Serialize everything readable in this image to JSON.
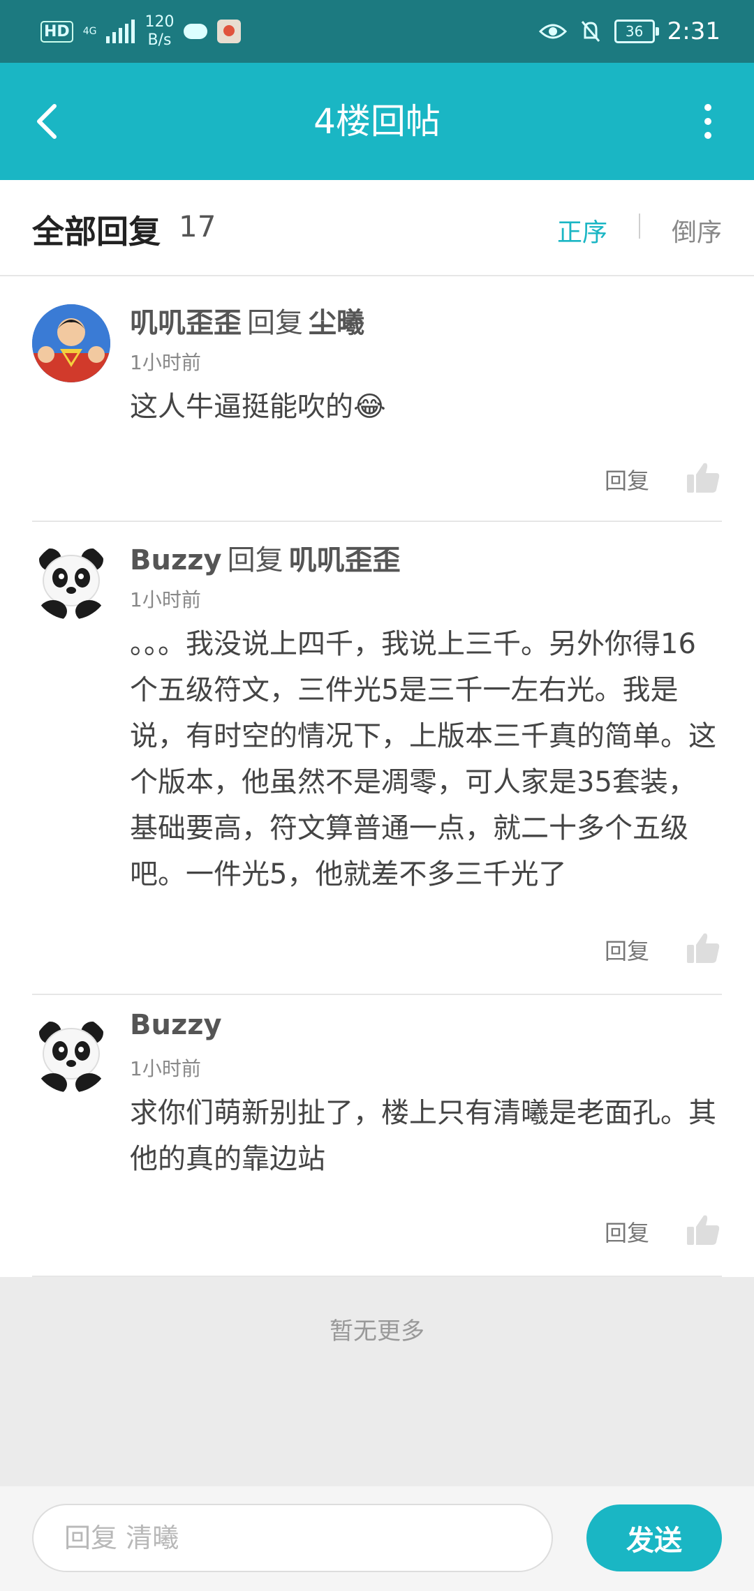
{
  "status_bar": {
    "hd": "HD",
    "network": "4G",
    "speed_value": "120",
    "speed_unit": "B/s",
    "battery": "36",
    "time": "2:31"
  },
  "nav": {
    "title": "4楼回帖",
    "icons": [
      "back-arrow-icon",
      "more-vertical-icon"
    ]
  },
  "replies_header": {
    "title": "全部回复",
    "count": "17",
    "sort_asc": "正序",
    "sort_desc": "倒序",
    "active_sort": "正序"
  },
  "replies": [
    {
      "user": "叽叽歪歪",
      "reply_word": "回复",
      "reply_to": "尘曦",
      "time": "1小时前",
      "content": "这人牛逼挺能吹的😂",
      "reply_label": "回复",
      "avatar": "superman-avatar"
    },
    {
      "user": "Buzzy",
      "reply_word": "回复",
      "reply_to": "叽叽歪歪",
      "time": "1小时前",
      "content": "。。。我没说上四千，我说上三千。另外你得16个五级符文，三件光5是三千一左右光。我是说，有时空的情况下，上版本三千真的简单。这个版本，他虽然不是凋零，可人家是35套装，基础要高，符文算普通一点，就二十多个五级吧。一件光5，他就差不多三千光了",
      "reply_label": "回复",
      "avatar": "panda-avatar"
    },
    {
      "user": "Buzzy",
      "time": "1小时前",
      "content": "求你们萌新别扯了，楼上只有清曦是老面孔。其他的真的靠边站",
      "reply_label": "回复",
      "avatar": "panda-avatar"
    }
  ],
  "footer": {
    "no_more": "暂无更多"
  },
  "input_bar": {
    "placeholder": "回复 清曦",
    "send_label": "发送"
  },
  "colors": {
    "accent": "#1ab6c4",
    "status_bar": "#1c7a80"
  }
}
